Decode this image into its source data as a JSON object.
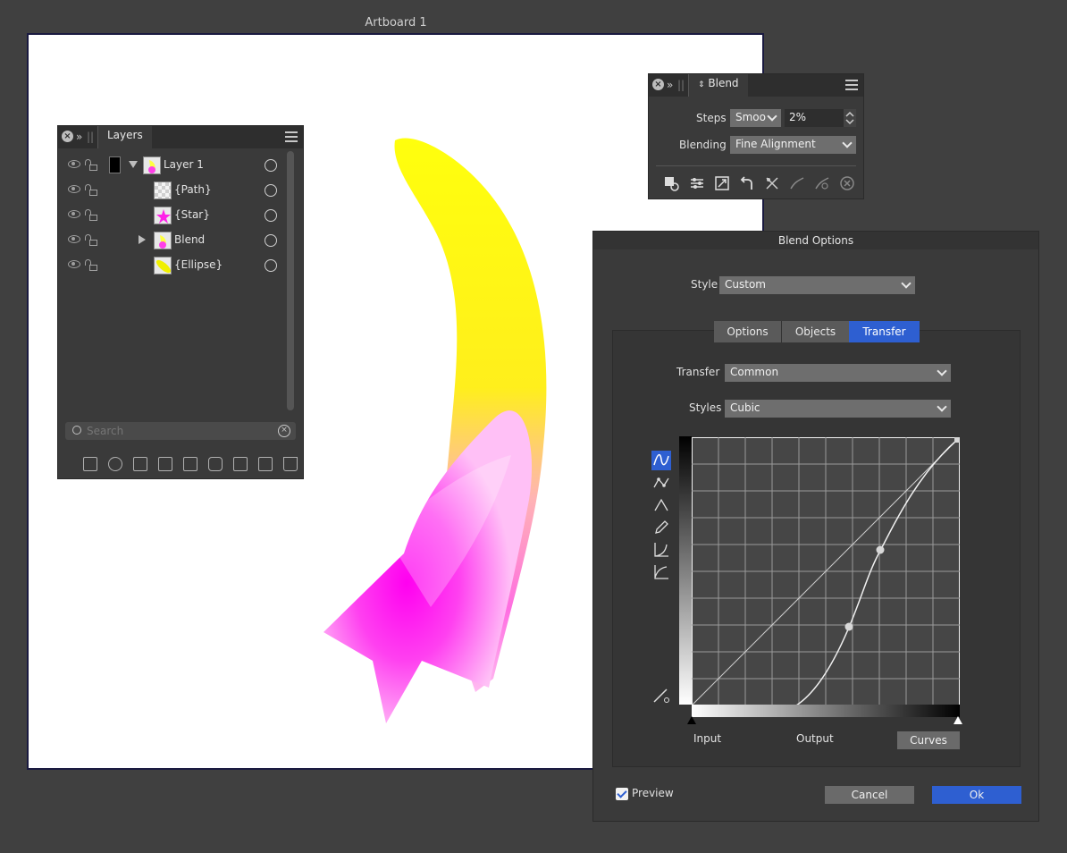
{
  "canvas": {
    "artboard_title": "Artboard 1"
  },
  "layers_panel": {
    "tab_label": "Layers",
    "items": [
      {
        "name": "Layer 1",
        "expanded": true
      },
      {
        "name": "{Path}"
      },
      {
        "name": "{Star}"
      },
      {
        "name": "Blend",
        "expandable": true
      },
      {
        "name": "{Ellipse}"
      }
    ],
    "search": {
      "placeholder": "Search",
      "value": ""
    }
  },
  "blend_panel": {
    "tab_label": "Blend",
    "steps_label": "Steps",
    "steps_mode": "Smoo",
    "steps_value": "2%",
    "blending_label": "Blending",
    "blending_value": "Fine Alignment"
  },
  "blend_options": {
    "title": "Blend Options",
    "style_label": "Style",
    "style_value": "Custom",
    "tabs": [
      "Options",
      "Objects",
      "Transfer"
    ],
    "active_tab": "Transfer",
    "transfer_label": "Transfer",
    "transfer_value": "Common",
    "styles_label": "Styles",
    "styles_value": "Cubic",
    "input_label": "Input",
    "output_label": "Output",
    "curves_button": "Curves",
    "preview_label": "Preview",
    "preview_checked": true,
    "cancel_label": "Cancel",
    "ok_label": "Ok"
  },
  "colors": {
    "accent": "#2e5fd1",
    "artwork_yellow": "#ffff00",
    "artwork_magenta": "#ff00ff"
  }
}
